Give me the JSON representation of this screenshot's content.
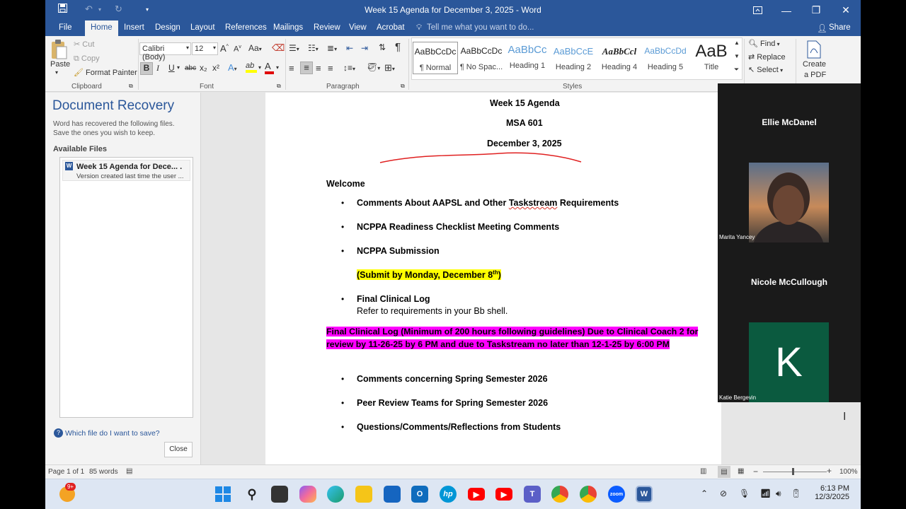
{
  "titlebar": {
    "title": "Week 15 Agenda for December 3, 2025 - Word",
    "save_icon": "save-icon",
    "undo_icon": "undo-icon",
    "redo_icon": "redo-icon",
    "customize_icon": "chevron-down-icon",
    "restore_icon": "ribbon-display-icon",
    "minimize": "—",
    "maximize": "❐",
    "close": "✕"
  },
  "tabs": [
    {
      "label": "File"
    },
    {
      "label": "Home"
    },
    {
      "label": "Insert"
    },
    {
      "label": "Design"
    },
    {
      "label": "Layout"
    },
    {
      "label": "References"
    },
    {
      "label": "Mailings"
    },
    {
      "label": "Review"
    },
    {
      "label": "View"
    },
    {
      "label": "Acrobat"
    }
  ],
  "tell_me": "Tell me what you want to do...",
  "share": "Share",
  "clipboard": {
    "paste": "Paste",
    "cut": "Cut",
    "copy": "Copy",
    "format_painter": "Format Painter",
    "label": "Clipboard"
  },
  "font": {
    "family": "Calibri (Body)",
    "size": "12",
    "bold": "B",
    "italic": "I",
    "underline": "U",
    "strike": "abc",
    "subscript": "x₂",
    "superscript": "x²",
    "grow": "A",
    "shrink": "A",
    "change_case": "Aa",
    "font_color": "A",
    "label": "Font"
  },
  "paragraph": {
    "label": "Paragraph",
    "pilcrow": "¶"
  },
  "styles": {
    "label": "Styles",
    "items": [
      {
        "preview": "AaBbCcDc",
        "name": "¶ Normal"
      },
      {
        "preview": "AaBbCcDc",
        "name": "¶ No Spac..."
      },
      {
        "preview": "AaBbCc",
        "name": "Heading 1"
      },
      {
        "preview": "AaBbCcE",
        "name": "Heading 2"
      },
      {
        "preview": "AaBbCcl",
        "name": "Heading 4"
      },
      {
        "preview": "AaBbCcDd",
        "name": "Heading 5"
      },
      {
        "preview": "AaB",
        "name": "Title"
      }
    ]
  },
  "editing": {
    "find": "Find",
    "replace": "Replace",
    "select": "Select"
  },
  "acrobat": {
    "create_pdf_line1": "Create",
    "create_pdf_line2": "a PDF"
  },
  "recovery": {
    "title": "Document Recovery",
    "description": "Word has recovered the following files.  Save the ones you wish to keep.",
    "available": "Available Files",
    "file_name": "Week 15 Agenda for Dece... .",
    "file_sub": "Version created last time the user ...",
    "which": "Which file do I want to save?",
    "close": "Close"
  },
  "document": {
    "title": "Week 15 Agenda",
    "course": "MSA 601",
    "date": "December 3, 2025",
    "welcome": "Welcome",
    "bullet_char": "•",
    "item1_a": "Comments About AAPSL and Other ",
    "item1_b": "Taskstream",
    "item1_c": " Requirements",
    "item2": "NCPPA Readiness Checklist Meeting Comments",
    "item3": "NCPPA Submission",
    "submit_by": "(Submit by Monday, December 8",
    "submit_sup": "th",
    "submit_end": ")",
    "item4": "Final Clinical Log",
    "item4_sub": "Refer to requirements in your Bb shell.",
    "highlight_line1": "Final Clinical Log (Minimum of 200 hours following guidelines) Due to Clinical Coach 2 for",
    "highlight_line2": "review by 11-26-25 by 6 PM and due to Taskstream no later than 12-1-25 by 6:00 PM",
    "item5": "Comments concerning Spring Semester 2026",
    "item6": "Peer Review Teams for Spring Semester 2026",
    "item7": "Questions/Comments/Reflections from Students"
  },
  "zoom": {
    "p1": "Ellie McDanel",
    "p2_small": "Marita Yancey",
    "p3": "Nicole McCullough",
    "p4_initial": "K",
    "p4_small": "Katie Bergevin",
    "tile_k_color": "#0b5a3f"
  },
  "status": {
    "page": "Page 1 of 1",
    "words": "85 words",
    "zoom": "100%"
  },
  "taskbar": {
    "weather_badge": "9+",
    "time": "6:13 PM",
    "date": "12/3/2025"
  }
}
